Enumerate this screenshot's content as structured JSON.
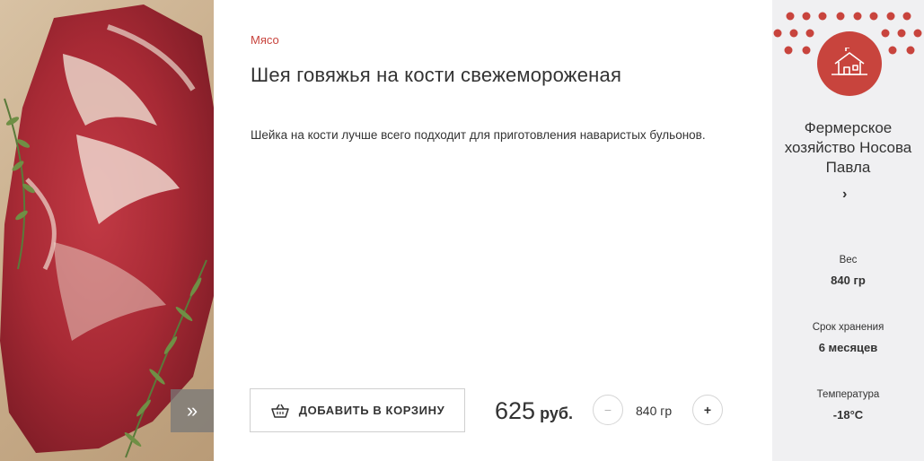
{
  "product": {
    "category": "Мясо",
    "title": "Шея говяжья на кости свежемороженая",
    "description": "Шейка на кости лучше всего подходит для приготовления наваристых бульонов."
  },
  "purchase": {
    "add_to_cart_label": "ДОБАВИТЬ В КОРЗИНУ",
    "price_value": "625",
    "price_currency": "руб.",
    "quantity": "840 гр",
    "minus_label": "−",
    "plus_label": "+"
  },
  "gallery": {
    "next_icon": "double-chevron-right-icon"
  },
  "farm": {
    "name": "Фермерское хозяйство Носова Павла",
    "logo_icon": "farmhouse-icon",
    "link_icon": "chevron-right-icon",
    "specs": [
      {
        "label": "Вес",
        "value": "840 гр"
      },
      {
        "label": "Срок хранения",
        "value": "6 месяцев"
      },
      {
        "label": "Температура",
        "value": "-18°C"
      }
    ]
  },
  "colors": {
    "accent": "#c8443d",
    "panel_bg": "#f0f0f2"
  }
}
